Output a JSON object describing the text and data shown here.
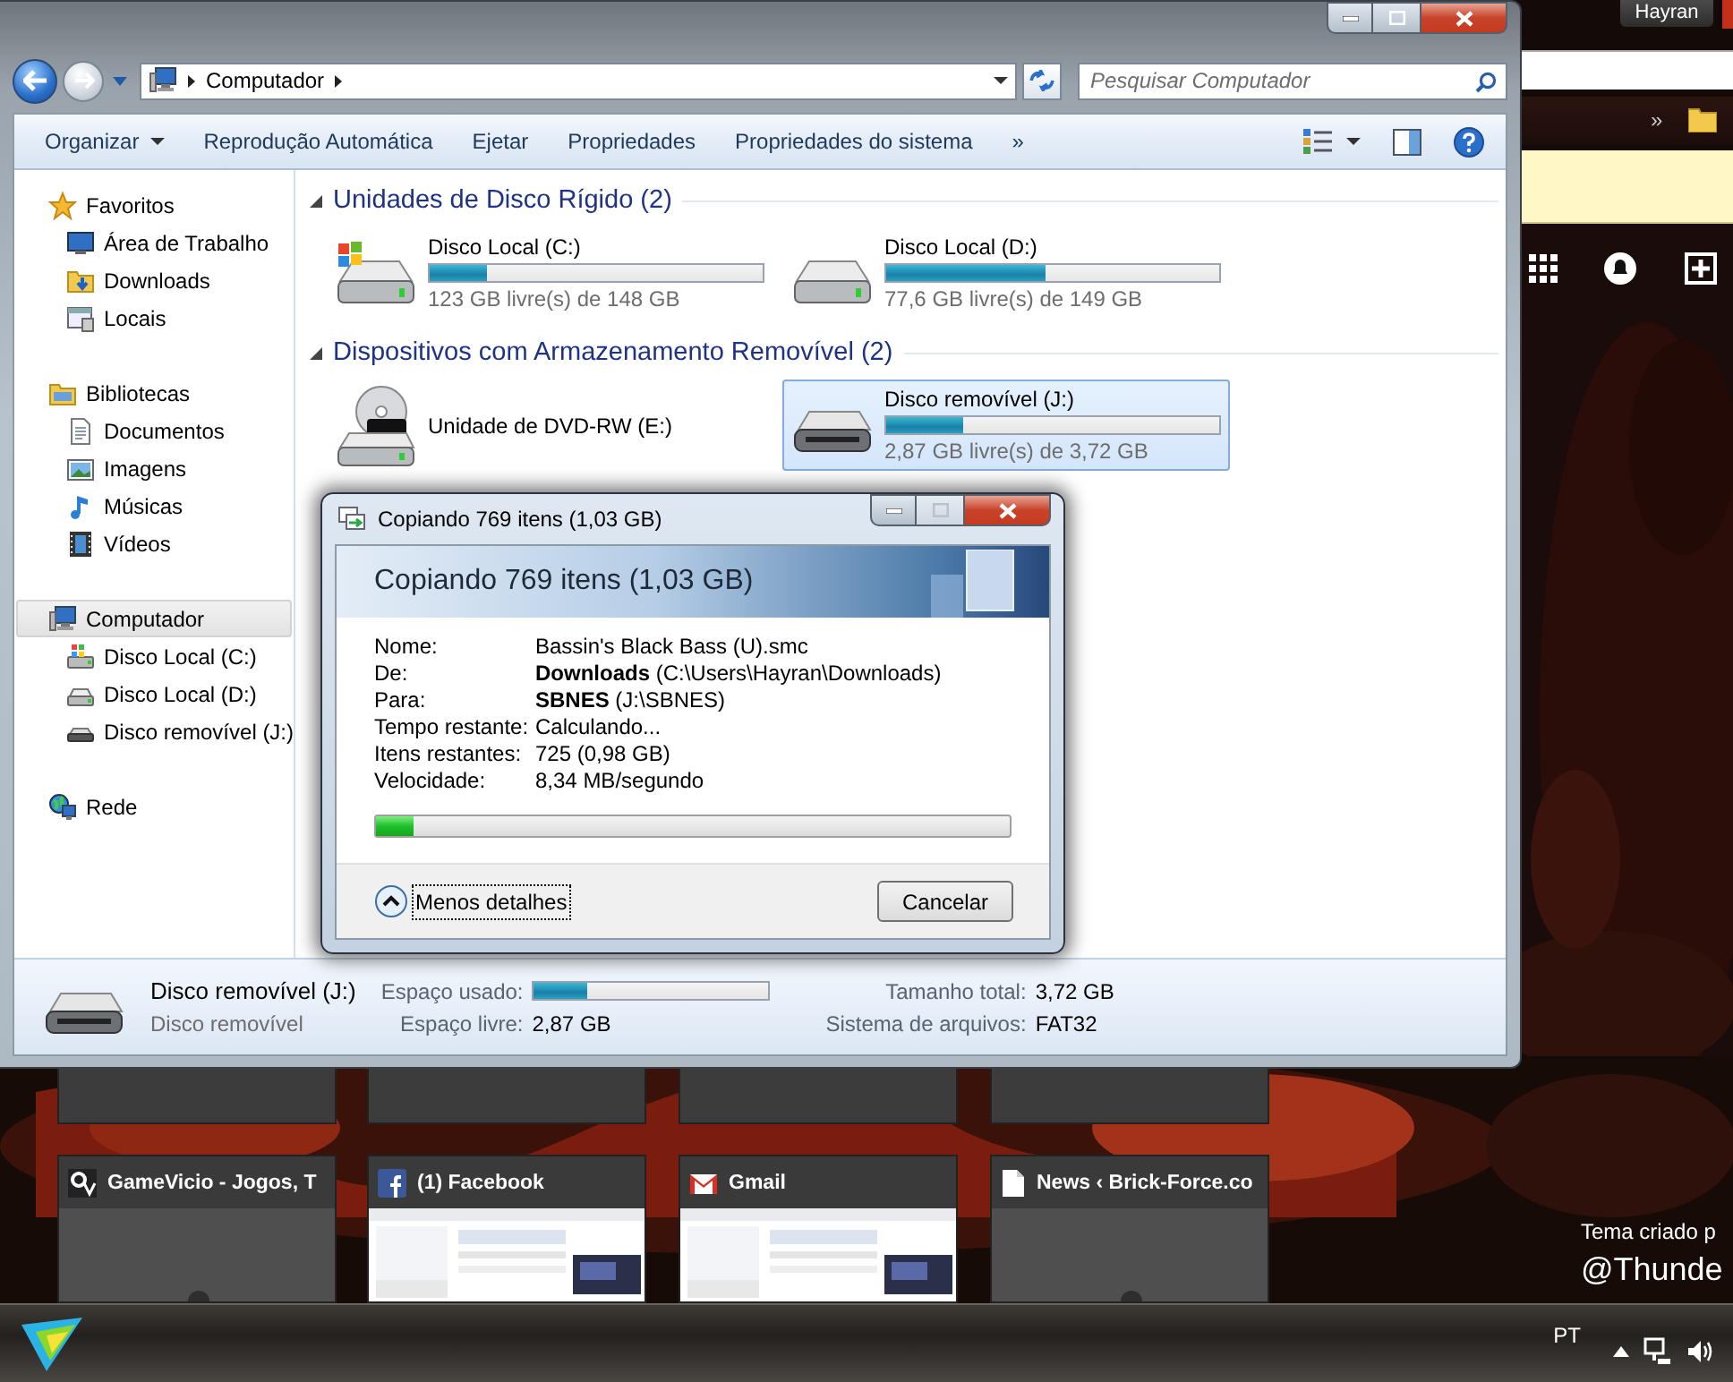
{
  "explorer": {
    "address": {
      "crumbs": [
        "Computador"
      ]
    },
    "search": {
      "placeholder": "Pesquisar Computador"
    },
    "toolbar": [
      {
        "label": "Organizar",
        "dropdown": true
      },
      {
        "label": "Reprodução Automática",
        "dropdown": false
      },
      {
        "label": "Ejetar",
        "dropdown": false
      },
      {
        "label": "Propriedades",
        "dropdown": false
      },
      {
        "label": "Propriedades do sistema",
        "dropdown": false
      },
      {
        "label": "»",
        "dropdown": false
      }
    ],
    "sidebar": [
      {
        "label": "Favoritos",
        "selected": false,
        "children": [
          {
            "label": "Área de Trabalho",
            "selected": false
          },
          {
            "label": "Downloads",
            "selected": false
          },
          {
            "label": "Locais",
            "selected": false
          }
        ]
      },
      {
        "label": "Bibliotecas",
        "selected": false,
        "children": [
          {
            "label": "Documentos",
            "selected": false
          },
          {
            "label": "Imagens",
            "selected": false
          },
          {
            "label": "Músicas",
            "selected": false
          },
          {
            "label": "Vídeos",
            "selected": false
          }
        ]
      },
      {
        "label": "Computador",
        "selected": true,
        "children": [
          {
            "label": "Disco Local (C:)",
            "selected": false
          },
          {
            "label": "Disco Local (D:)",
            "selected": false
          },
          {
            "label": "Disco removível (J:)",
            "selected": false
          }
        ]
      },
      {
        "label": "Rede",
        "selected": false
      }
    ],
    "groups": [
      {
        "title": "Unidades de Disco Rígido (2)",
        "expanded": true,
        "drives": [
          {
            "kind": "system",
            "name": "Disco Local (C:)",
            "level": 0.17,
            "free": "123 GB livre(s) de 148 GB",
            "selected": false
          },
          {
            "kind": "hdd",
            "name": "Disco Local (D:)",
            "level": 0.48,
            "free": "77,6 GB livre(s) de 149 GB",
            "selected": false
          }
        ]
      },
      {
        "title": "Dispositivos com Armazenamento Removível (2)",
        "expanded": true,
        "drives": [
          {
            "kind": "dvd",
            "name": "Unidade de DVD-RW (E:)",
            "selected": false
          },
          {
            "kind": "removable",
            "name": "Disco removível (J:)",
            "level": 0.23,
            "free": "2,87 GB livre(s) de 3,72 GB",
            "selected": true
          }
        ]
      }
    ],
    "details": {
      "name": "Disco removível (J:)",
      "type": "Disco removível",
      "fields": [
        {
          "kind": "bar",
          "label": "Espaço usado:",
          "level": 0.23
        },
        {
          "kind": "text",
          "label": "Tamanho total:",
          "value": "3,72 GB"
        },
        {
          "kind": "text",
          "label": "Espaço livre:",
          "value": "2,87 GB"
        },
        {
          "kind": "text",
          "label": "Sistema de arquivos:",
          "value": "FAT32"
        }
      ]
    }
  },
  "copy_dialog": {
    "title": "Copiando 769 itens (1,03 GB)",
    "heading": "Copiando 769 itens (1,03 GB)",
    "rows": [
      {
        "label": "Nome:",
        "value": "Bassin's Black Bass (U).smc"
      },
      {
        "label": "De:",
        "value": "**Downloads** (C:\\Users\\Hayran\\Downloads)"
      },
      {
        "label": "Para:",
        "value": "**SBNES** (J:\\SBNES)"
      },
      {
        "label": "Tempo restante:",
        "value": "Calculando..."
      },
      {
        "label": "Itens restantes:",
        "value": "725 (0,98 GB)"
      },
      {
        "label": "Velocidade:",
        "value": "8,34 MB/segundo"
      }
    ],
    "level": 0.06,
    "maximize_disabled": true,
    "details_toggle": "Menos detalhes",
    "cancel": "Cancelar"
  },
  "browser": {
    "user": "Hayran",
    "bookmarks_more": "»",
    "tiles": [
      {
        "kind": "blank",
        "title": "GameVicio - Jogos, T"
      },
      {
        "kind": "picture",
        "title": "(1) Facebook"
      },
      {
        "kind": "picture",
        "title": "Gmail"
      },
      {
        "kind": "blank",
        "title": "News ‹ Brick-Force.co"
      }
    ],
    "theme_credit": "Tema criado p",
    "theme_author": "@Thunde"
  },
  "taskbar": {
    "language": "PT"
  }
}
